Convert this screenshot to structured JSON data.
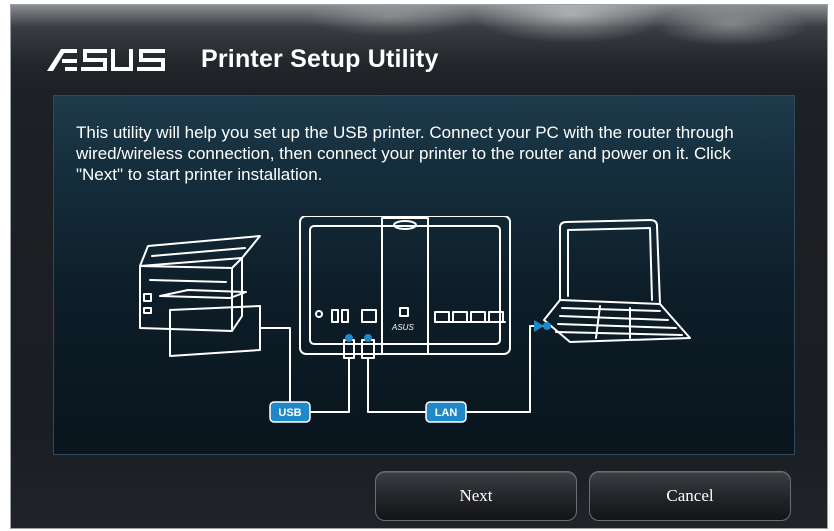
{
  "window": {
    "logo_text": "ASUS",
    "title": "Printer Setup Utility"
  },
  "main": {
    "description": "This utility will help you set up the USB printer. Connect your PC with the router through wired/wireless connection, then connect your printer to the router and power on it. Click \"Next\" to start printer installation.",
    "diagram": {
      "usb_label": "USB",
      "lan_label": "LAN",
      "router_brand": "ASUS",
      "accent_color": "#1e88c8"
    }
  },
  "footer": {
    "next_label": "Next",
    "cancel_label": "Cancel"
  }
}
